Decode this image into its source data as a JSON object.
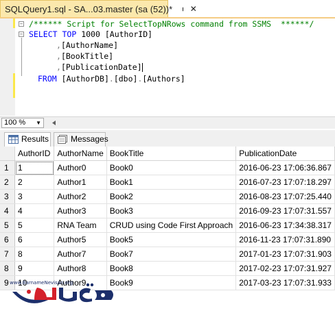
{
  "tab": {
    "title": "SQLQuery1.sql - SA...03.master (sa (52))*",
    "pin_icon": "pin-icon",
    "close_icon": "close-icon"
  },
  "editor": {
    "comment": "/****** Script for SelectTopNRows command from SSMS  ******/",
    "select_kw": "SELECT",
    "top_kw": "TOP",
    "top_value": "1000",
    "col1": "[AuthorID]",
    "col2": "[AuthorName]",
    "col3": "[BookTitle]",
    "col4": "[PublicationDate]",
    "comma": ",",
    "from_kw": "FROM",
    "table_db": "[AuthorDB]",
    "table_schema": "[dbo]",
    "table_name": "[Authors]",
    "dot": "."
  },
  "zoom": {
    "value": "100 %",
    "arrow_icon": "chevron-down-icon"
  },
  "results_tabs": [
    {
      "label": "Results",
      "icon": "grid-icon",
      "active": true
    },
    {
      "label": "Messages",
      "icon": "messages-icon",
      "active": false
    }
  ],
  "grid": {
    "columns": [
      "AuthorID",
      "AuthorName",
      "BookTitle",
      "PublicationDate"
    ],
    "rows": [
      {
        "n": "1",
        "AuthorID": "1",
        "AuthorName": "Author0",
        "BookTitle": "Book0",
        "PublicationDate": "2016-06-23 17:06:36.867"
      },
      {
        "n": "2",
        "AuthorID": "2",
        "AuthorName": "Author1",
        "BookTitle": "Book1",
        "PublicationDate": "2016-07-23 17:07:18.297"
      },
      {
        "n": "3",
        "AuthorID": "3",
        "AuthorName": "Author2",
        "BookTitle": "Book2",
        "PublicationDate": "2016-08-23 17:07:25.440"
      },
      {
        "n": "4",
        "AuthorID": "4",
        "AuthorName": "Author3",
        "BookTitle": "Book3",
        "PublicationDate": "2016-09-23 17:07:31.557"
      },
      {
        "n": "5",
        "AuthorID": "5",
        "AuthorName": "RNA Team",
        "BookTitle": "CRUD using Code First Approach",
        "PublicationDate": "2016-06-23 17:34:38.317"
      },
      {
        "n": "6",
        "AuthorID": "6",
        "AuthorName": "Author5",
        "BookTitle": "Book5",
        "PublicationDate": "2016-11-23 17:07:31.890"
      },
      {
        "n": "7",
        "AuthorID": "8",
        "AuthorName": "Author7",
        "BookTitle": "Book7",
        "PublicationDate": "2017-01-23 17:07:31.903"
      },
      {
        "n": "8",
        "AuthorID": "9",
        "AuthorName": "Author8",
        "BookTitle": "Book8",
        "PublicationDate": "2017-02-23 17:07:31.927"
      },
      {
        "n": "9",
        "AuthorID": "10",
        "AuthorName": "Author9",
        "BookTitle": "Book9",
        "PublicationDate": "2017-03-23 17:07:31.933"
      }
    ]
  },
  "watermark": {
    "url": "www.BarnameNevisan.org",
    "logo_text": "برنامه نویسان"
  },
  "colors": {
    "tab_active": "#fbe8ac",
    "keyword": "#0000ff",
    "comment": "#008000",
    "operator": "#808080",
    "logo_red": "#d4202a",
    "logo_navy": "#1c2f6b"
  }
}
